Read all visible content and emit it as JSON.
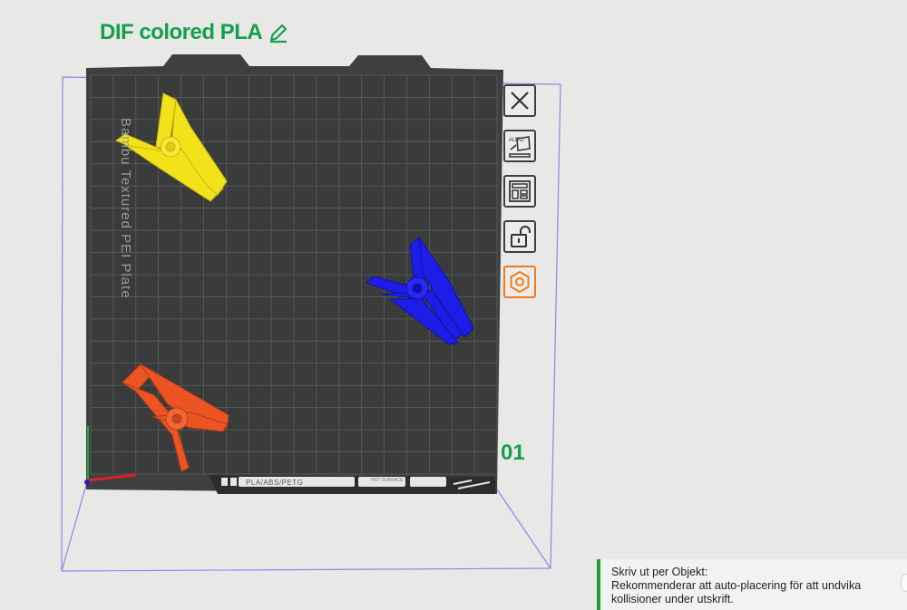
{
  "plate": {
    "name": "DIF colored PLA",
    "label": "Bambu Textured PEI Plate",
    "number": "01",
    "strip_text": "PLA/ABS/PETG",
    "hot_surface": "HOT SURFACE"
  },
  "toolbar": {
    "items": [
      {
        "icon": "close-icon"
      },
      {
        "icon": "auto-orient-icon",
        "text": "AUTO"
      },
      {
        "icon": "arrange-layout-icon"
      },
      {
        "icon": "unlock-icon"
      },
      {
        "icon": "plate-settings-icon",
        "accent": "#f07a1a"
      }
    ]
  },
  "objects": [
    {
      "name": "clip-part",
      "color": "#f5e618"
    },
    {
      "name": "clip-part",
      "color": "#1e1ee6"
    },
    {
      "name": "clip-part",
      "color": "#ec5424"
    }
  ],
  "notification": {
    "title": "Skriv ut per Objekt:",
    "message": "Rekommenderar att auto-placering för att undvika kollisioner under utskrift."
  },
  "colors": {
    "title_green": "#14a04a",
    "plate_dark": "#3d3f3f",
    "grid_line": "#5a5c5c",
    "bbox_line": "#7b7bf0"
  }
}
